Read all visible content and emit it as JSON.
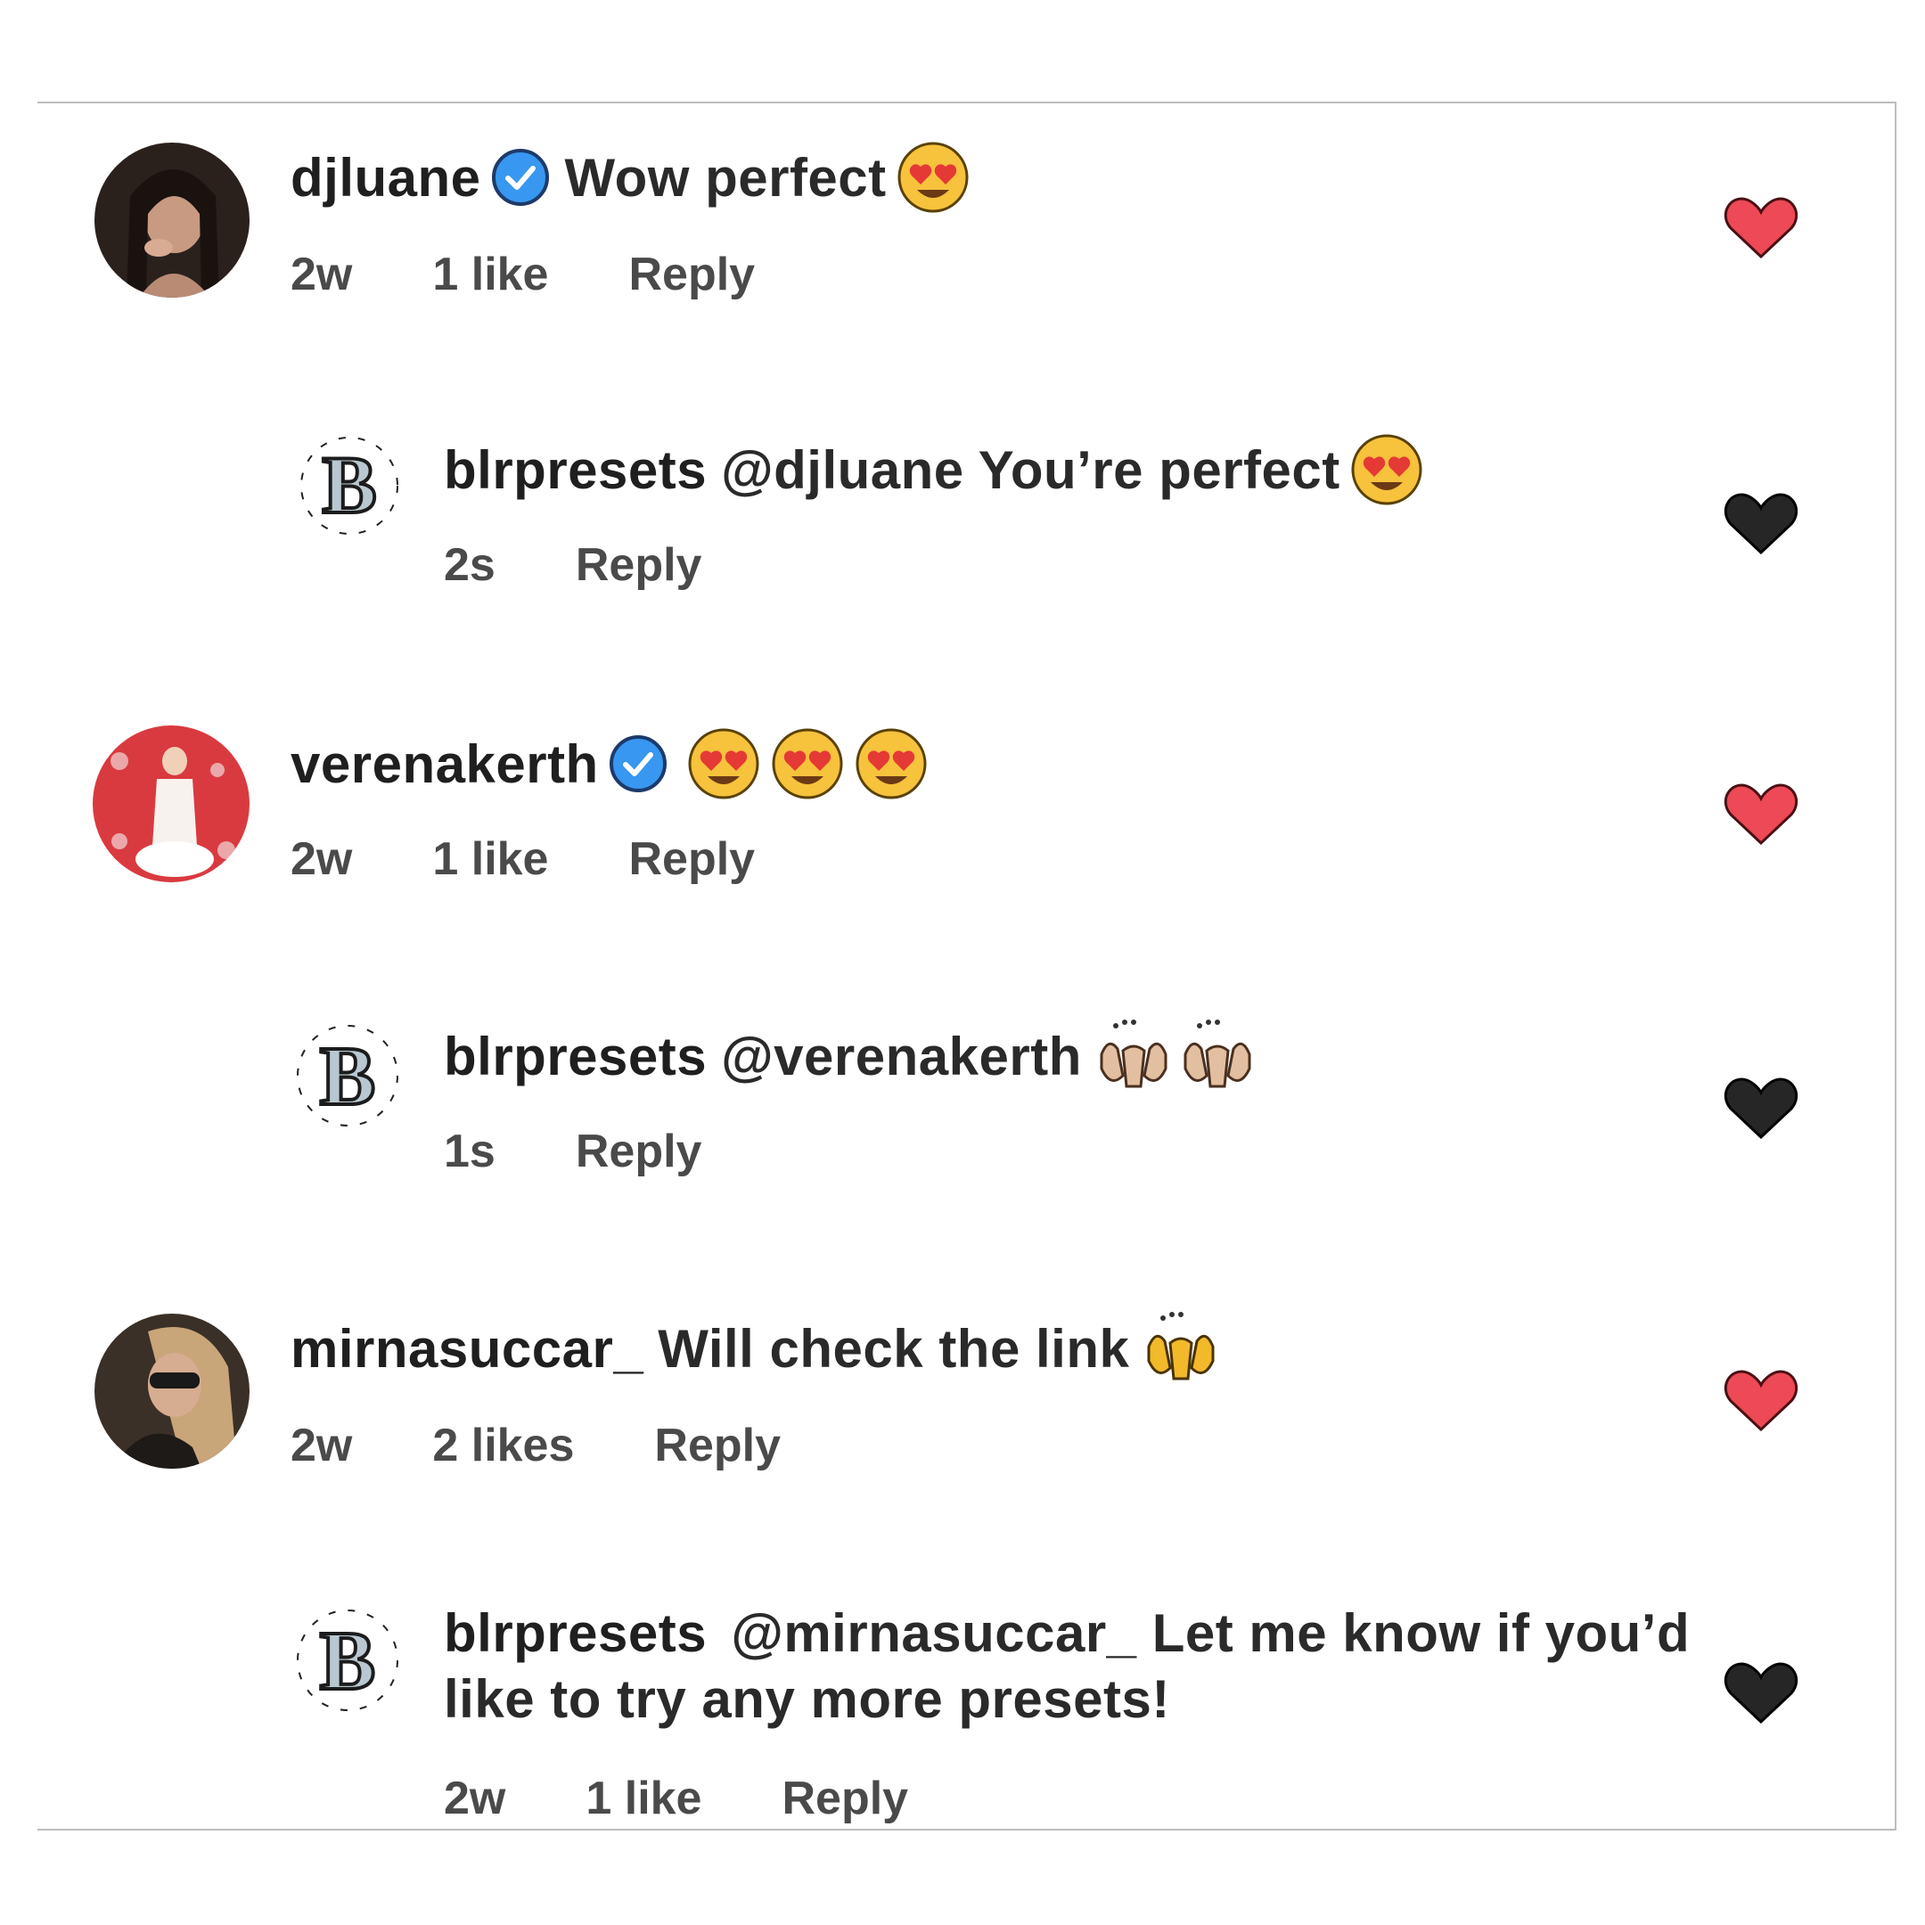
{
  "comments": [
    {
      "username": "djluane",
      "verified": true,
      "text": "Wow perfect",
      "emoji": [
        "heart-eyes"
      ],
      "time": "2w",
      "likes": "1 like",
      "reply": "Reply",
      "liked": true
    },
    {
      "username": "blrpresets",
      "verified": false,
      "text": "@djluane You’re perfect",
      "emoji": [
        "heart-eyes"
      ],
      "time": "2s",
      "likes": "",
      "reply": "Reply",
      "liked": false
    },
    {
      "username": "verenakerth",
      "verified": true,
      "text": "",
      "emoji": [
        "heart-eyes",
        "heart-eyes",
        "heart-eyes"
      ],
      "time": "2w",
      "likes": "1 like",
      "reply": "Reply",
      "liked": true
    },
    {
      "username": "blrpresets",
      "verified": false,
      "text": "@verenakerth",
      "emoji": [
        "raising-hands-light",
        "raising-hands-light"
      ],
      "time": "1s",
      "likes": "",
      "reply": "Reply",
      "liked": false
    },
    {
      "username": "mirnasuccar_",
      "verified": false,
      "text": "Will check the link",
      "emoji": [
        "raising-hands"
      ],
      "time": "2w",
      "likes": "2 likes",
      "reply": "Reply",
      "liked": true
    },
    {
      "username": "blrpresets",
      "verified": false,
      "text": "@mirnasuccar_ Let me know if you’d like to try any more presets!",
      "emoji": [],
      "time": "2w",
      "likes": "1 like",
      "reply": "Reply",
      "liked": false
    }
  ],
  "colors": {
    "liked_heart": "#ed4956",
    "unliked_heart": "#262626",
    "verified_badge": "#3897f0"
  }
}
